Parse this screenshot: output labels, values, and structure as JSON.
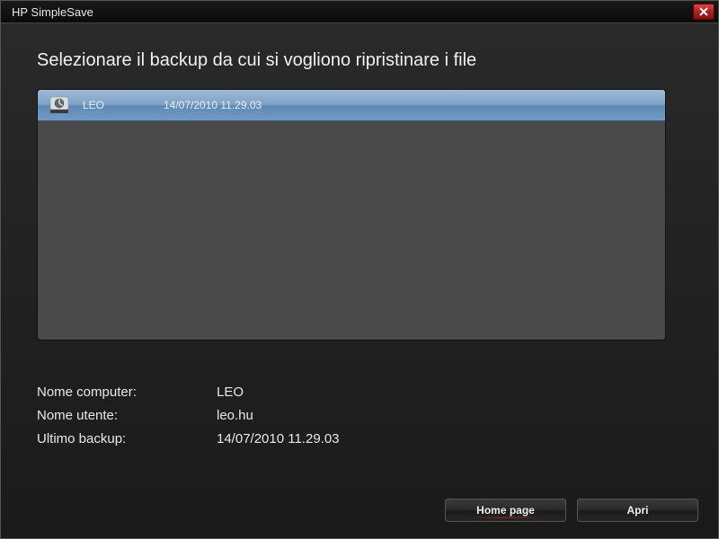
{
  "window": {
    "title": "HP SimpleSave"
  },
  "main": {
    "heading": "Selezionare il backup da cui si vogliono ripristinare i file",
    "backup_list": [
      {
        "name": "LEO",
        "timestamp": "14/07/2010 11.29.03"
      }
    ]
  },
  "details": {
    "computer_label": "Nome computer:",
    "computer_value": "LEO",
    "user_label": "Nome utente:",
    "user_value": "leo.hu",
    "lastbackup_label": "Ultimo backup:",
    "lastbackup_value": "14/07/2010 11.29.03"
  },
  "buttons": {
    "home": "Home page",
    "open": "Apri"
  }
}
